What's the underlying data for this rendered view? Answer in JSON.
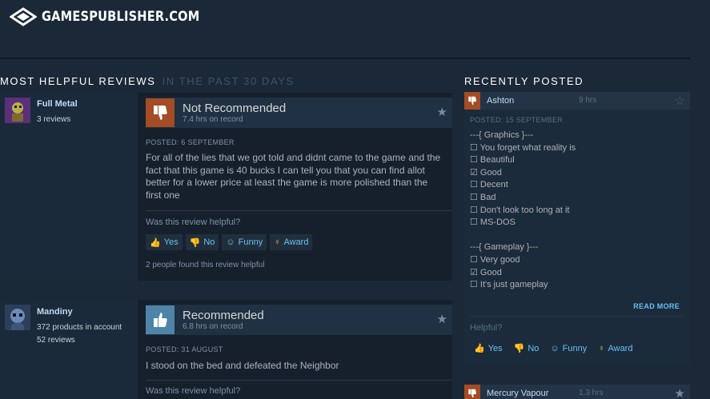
{
  "site": {
    "logo_text": "GAMESPUBLISHER.COM"
  },
  "helpful_section": {
    "title": "MOST HELPFUL REVIEWS",
    "subtitle": "IN THE PAST 30 DAYS"
  },
  "recent_section": {
    "title": "RECENTLY POSTED"
  },
  "reviews": [
    {
      "author": "Full Metal",
      "meta": [
        "3 reviews"
      ],
      "verdict": "Not Recommended",
      "hours": "7.4 hrs on record",
      "posted": "POSTED: 6 SEPTEMBER",
      "text": "For all of the lies that we got told and didnt came to the game and the fact that this game is 40 bucks I can tell you that you can find allot better for a lower price at least the game is more polished than the first one",
      "helpful_question": "Was this review helpful?",
      "buttons": {
        "yes": "Yes",
        "no": "No",
        "funny": "Funny",
        "award": "Award"
      },
      "found_helpful": "2 people found this review helpful"
    },
    {
      "author": "Mandiny",
      "meta": [
        "372 products in account",
        "52 reviews"
      ],
      "verdict": "Recommended",
      "hours": "6.8 hrs on record",
      "posted": "POSTED: 31 AUGUST",
      "text": "I stood on the bed and defeated the Neighbor",
      "helpful_question": "Was this review helpful?"
    }
  ],
  "recent": [
    {
      "author": "Ashton",
      "hours": "9 hrs",
      "posted": "POSTED: 15 SEPTEMBER",
      "lines": [
        "---{ Graphics }---",
        "☐ You forget what reality is",
        "☐ Beautiful",
        "☑ Good",
        "☐ Decent",
        "☐ Bad",
        "☐ Don't look too long at it",
        "☐ MS-DOS",
        "",
        "---{ Gameplay }---",
        "☐ Very good",
        "☑ Good",
        "☐ It's just gameplay"
      ],
      "read_more": "READ MORE",
      "helpful_question": "Helpful?",
      "buttons": {
        "yes": "Yes",
        "no": "No",
        "funny": "Funny",
        "award": "Award"
      }
    },
    {
      "author": "Mercury Vapour",
      "hours": "1.3 hrs"
    }
  ],
  "colors": {
    "background": "#1b2838",
    "accent_blue": "#66c0f4",
    "not_recommended": "#a34c25",
    "recommended": "#4e84a8"
  }
}
